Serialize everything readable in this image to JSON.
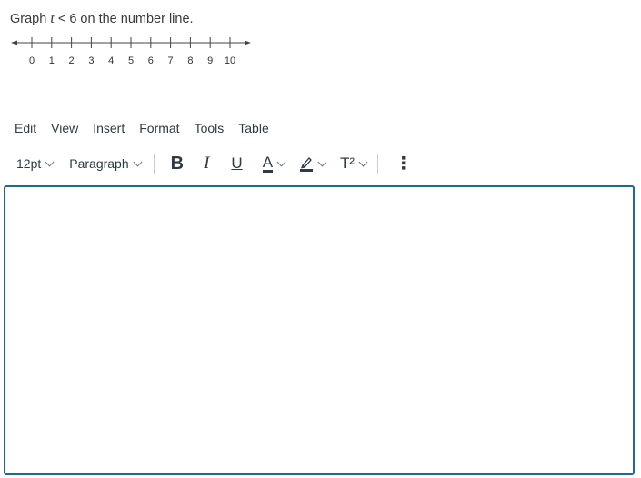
{
  "question": {
    "prefix": "Graph ",
    "variable": "t",
    "relation": " < 6 on the number line."
  },
  "number_line": {
    "ticks": [
      "0",
      "1",
      "2",
      "3",
      "4",
      "5",
      "6",
      "7",
      "8",
      "9",
      "10"
    ]
  },
  "menubar": {
    "items": [
      "Edit",
      "View",
      "Insert",
      "Format",
      "Tools",
      "Table"
    ]
  },
  "toolbar": {
    "font_size": "12pt",
    "block_format": "Paragraph",
    "bold_icon": "B",
    "italic_icon": "I",
    "underline_icon": "U",
    "text_color_icon": "A",
    "superscript_icon": "T²",
    "more_icon": "⋮"
  },
  "editor": {
    "content": ""
  },
  "colors": {
    "accent": "#1f6b8e",
    "text": "#2d3b45"
  }
}
